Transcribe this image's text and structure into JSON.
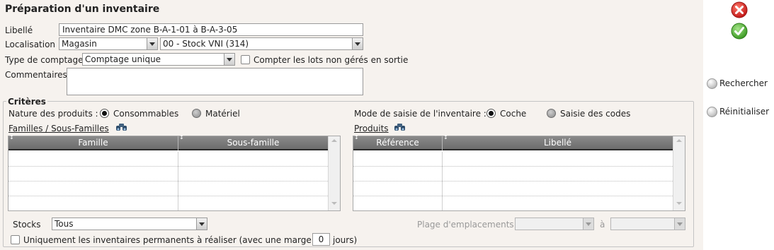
{
  "header": {
    "title": "Préparation d'un inventaire"
  },
  "form": {
    "libelle_label": "Libellé",
    "libelle_value": "Inventaire DMC zone B-A-1-01 à B-A-3-05",
    "localisation_label": "Localisation",
    "localisation_type": "Magasin",
    "localisation_stock": "00 - Stock VNI (314)",
    "type_comptage_label": "Type de comptage",
    "type_comptage_value": "Comptage unique",
    "compter_lots_label": "Compter les lots non gérés en sortie",
    "commentaires_label": "Commentaires"
  },
  "criteres": {
    "legend": "Critères",
    "nature_label": "Nature des produits :",
    "nature_options": [
      "Consommables",
      "Matériel"
    ],
    "mode_label": "Mode de saisie de l'inventaire :",
    "mode_options": [
      "Coche",
      "Saisie des codes"
    ],
    "familles_link": "Familles / Sous-Familles",
    "produits_link": "Produits",
    "familles_columns": [
      "Famille",
      "Sous-famille"
    ],
    "produits_columns": [
      "Référence",
      "Libellé"
    ],
    "stocks_label": "Stocks",
    "stocks_value": "Tous",
    "plage_label": "Plage d'emplacements",
    "plage_a": "à",
    "permanents_label": "Uniquement les inventaires permanents à réaliser (avec une marge de",
    "marge_value": "0",
    "jours_label": "jours)"
  },
  "sidebar": {
    "rechercher": "Rechercher",
    "reinitialiser": "Réinitialiser"
  },
  "colors": {
    "background": "#f6f2ee",
    "header_grid": "#7a7a7a",
    "cancel": "#d62a2a",
    "validate": "#4caa2d"
  }
}
